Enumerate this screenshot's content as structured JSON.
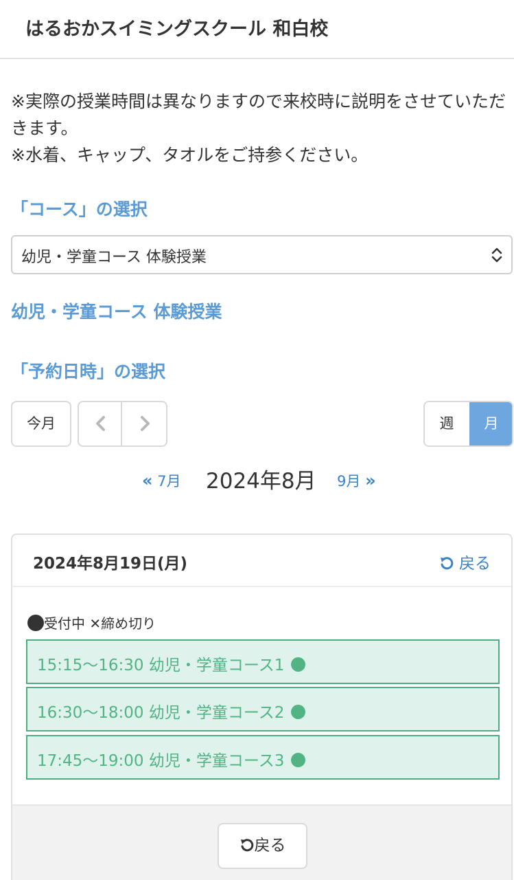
{
  "header": {
    "title": "はるおかスイミングスクール 和白校"
  },
  "notes": [
    "※実際の授業時間は異なりますので来校時に説明をさせていただきます。",
    "※水着、キャップ、タオルをご持参ください。"
  ],
  "course": {
    "heading": "「コース」の選択",
    "selected": "幼児・学童コース 体験授業",
    "selected_title": "幼児・学童コース 体験授業"
  },
  "datetime": {
    "heading": "「予約日時」の選択"
  },
  "calendar_toolbar": {
    "today_label": "今月",
    "prev_icon": "chevron-left-icon",
    "next_icon": "chevron-right-icon",
    "week_label": "週",
    "month_label": "月",
    "active_view": "月"
  },
  "month_nav": {
    "prev_label": "7月",
    "current": "2024年8月",
    "next_label": "9月"
  },
  "day_panel": {
    "date": "2024年8月19日(月)",
    "back_label": "戻る",
    "legend": {
      "open_label": "受付中",
      "closed_symbol": "✕",
      "closed_label": "締め切り"
    },
    "slots": [
      {
        "label": "15:15〜16:30 幼児・学童コース1"
      },
      {
        "label": "16:30〜18:00 幼児・学童コース2"
      },
      {
        "label": "17:45〜19:00 幼児・学童コース3"
      }
    ],
    "footer_back_label": "戻る"
  },
  "colors": {
    "accent": "#5b9bd5",
    "link": "#3a82c7",
    "active_view": "#6ea6e0",
    "slot_border": "#4cae80",
    "slot_bg": "#dff2ec",
    "slot_text": "#52b385"
  }
}
